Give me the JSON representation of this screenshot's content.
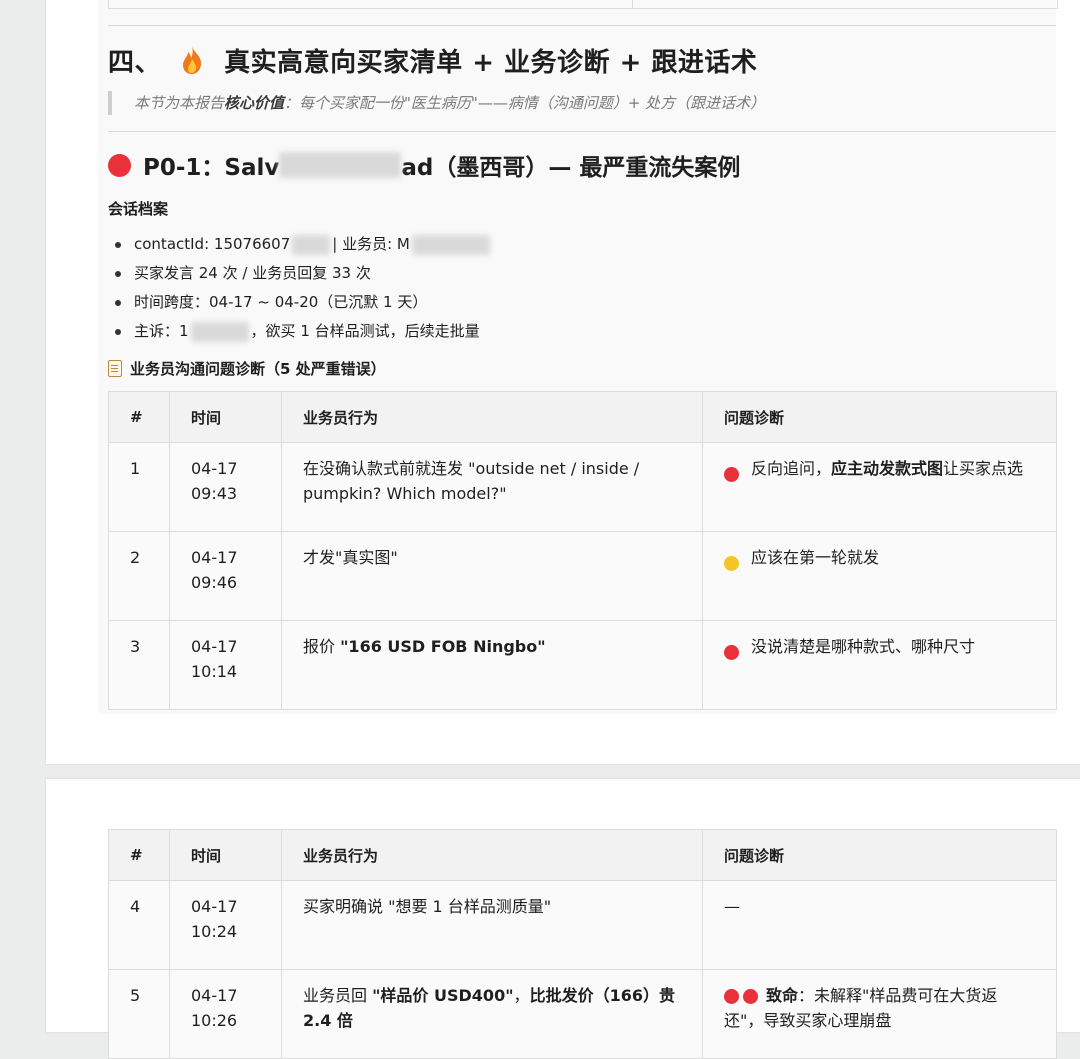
{
  "section": {
    "number": "四、",
    "title": "真实高意向买家清单 + 业务诊断 + 跟进话术",
    "quote_prefix": "本节为本报告",
    "quote_bold": "核心价值",
    "quote_suffix": "：每个买家配一份\"医生病历\"——病情（沟通问题）+ 处方（跟进话术）"
  },
  "case": {
    "title_prefix": "P0-1：Salv",
    "title_suffix": "ad（墨西哥）— 最严重流失案例",
    "archive_label": "会话档案",
    "meta": [
      {
        "a": "contactId: 15076607",
        "b": "| 业务员: M"
      },
      {
        "a": "买家发言 24 次 / 业务员回复 33 次",
        "b": ""
      },
      {
        "a": "时间跨度：04-17 ~ 04-20（已沉默 1 天）",
        "b": ""
      },
      {
        "a": "主诉：1",
        "b": "，欲买 1 台样品测试，后续走批量"
      }
    ],
    "diag_title": "业务员沟通问题诊断（5 处严重错误）"
  },
  "table": {
    "headers": [
      "#",
      "时间",
      "业务员行为",
      "问题诊断"
    ],
    "rows": [
      {
        "n": "1",
        "date": "04-17",
        "time": "09:43",
        "action": "在没确认款式前就连发 \"outside net / inside / pumpkin? Which model?\"",
        "diag_pre": "反向追问，",
        "diag_bold": "应主动发款式图",
        "diag_post": "让买家点选"
      },
      {
        "n": "2",
        "date": "04-17",
        "time": "09:46",
        "action": "才发\"真实图\"",
        "diag_pre": "应该在第一轮就发",
        "diag_bold": "",
        "diag_post": ""
      },
      {
        "n": "3",
        "date": "04-17",
        "time": "10:14",
        "action_pre": "报价 ",
        "action_bold": "\"166 USD FOB Ningbo\"",
        "diag_pre": "没说清楚是哪种款式、哪种尺寸",
        "diag_bold": "",
        "diag_post": ""
      },
      {
        "n": "4",
        "date": "04-17",
        "time": "10:24",
        "action": "买家明确说 \"想要 1 台样品测质量\"",
        "diag": "—"
      },
      {
        "n": "5",
        "date": "04-17",
        "time": "10:26",
        "action_pre": "业务员回 ",
        "action_bold1": "\"样品价 USD400\"",
        "action_mid": "，",
        "action_bold2": "比批发价（166）贵 2.4 倍",
        "diag_bold": "致命",
        "diag_post": "：未解释\"样品费可在大货返还\"，导致买家心理崩盘"
      }
    ]
  },
  "colors": {
    "red": "#e8313b",
    "yellow": "#f5c426",
    "fire": "#f07a1a"
  }
}
